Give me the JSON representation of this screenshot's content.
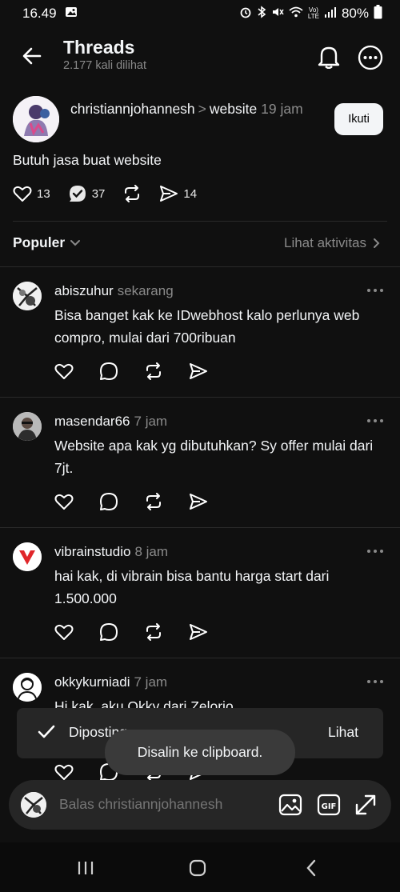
{
  "status_bar": {
    "time": "16.49",
    "battery": "80%",
    "icons": [
      "image-icon",
      "alarm-icon",
      "bluetooth-icon",
      "mute-icon",
      "wifi-icon",
      "volte-icon",
      "signal-icon",
      "battery-icon"
    ]
  },
  "header": {
    "title": "Threads",
    "views": "2.177 kali dilihat"
  },
  "main_post": {
    "username": "christiannjohannesh",
    "separator": ">",
    "topic": "website",
    "time": "19 jam",
    "follow_label": "Ikuti",
    "text": "Butuh jasa buat website",
    "likes": "13",
    "replies": "37",
    "shares": "14"
  },
  "sort": {
    "label": "Populer",
    "activity_label": "Lihat aktivitas"
  },
  "replies": [
    {
      "username": "abiszuhur",
      "time": "sekarang",
      "text": "Bisa banget kak ke IDwebhost kalo perlunya web compro, mulai dari 700ribuan"
    },
    {
      "username": "masendar66",
      "time": "7 jam",
      "text": "Website apa kak yg dibutuhkan? Sy offer mulai dari 7jt."
    },
    {
      "username": "vibrainstudio",
      "time": "8 jam",
      "text": "hai kak, di vibrain bisa bantu harga start dari 1.500.000"
    },
    {
      "username": "okkykurniadi",
      "time": "7 jam",
      "text": "Hi kak, aku Okky dari Zelorio"
    }
  ],
  "toast_posted": {
    "label": "Diposting",
    "action": "Lihat"
  },
  "toast_clipboard": {
    "text": "Disalin ke clipboard."
  },
  "composer": {
    "placeholder": "Balas christiannjohannesh"
  },
  "colors": {
    "background": "#101010",
    "text": "#f3f5f7",
    "muted": "#8a8a8a",
    "surface": "#262626"
  }
}
